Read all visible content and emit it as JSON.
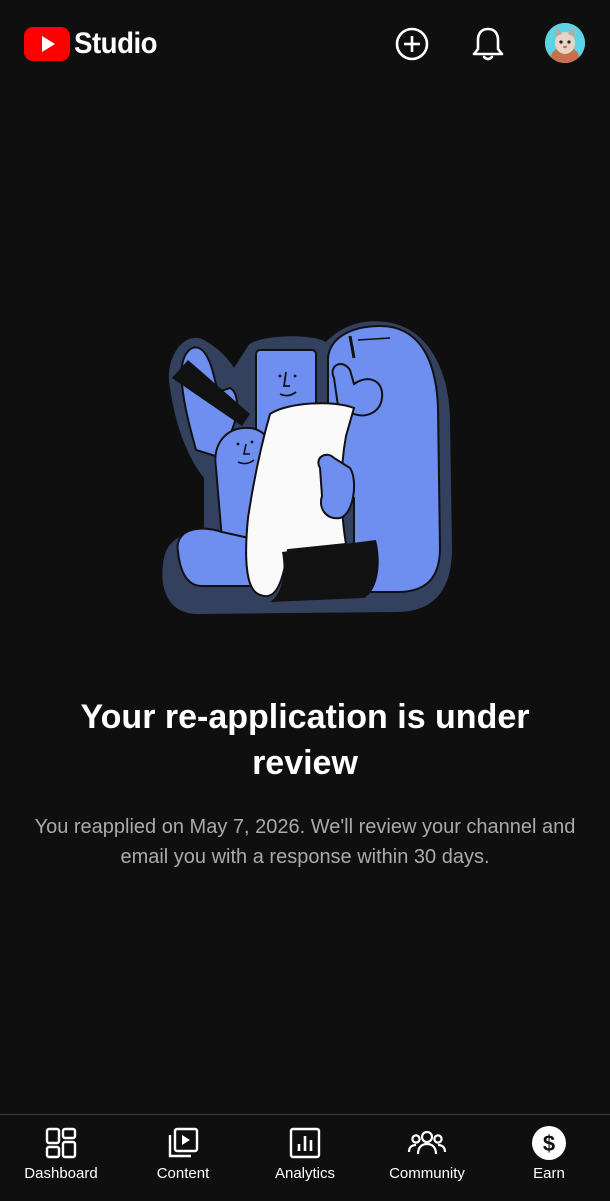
{
  "header": {
    "logo_text": "Studio",
    "icons": [
      "create-icon",
      "notifications-icon",
      "avatar"
    ]
  },
  "main": {
    "title": "Your re-application is under review",
    "subtitle": "You reapplied on May 7, 2026. We'll review your channel and email you with a response within 30 days."
  },
  "bottom_nav": {
    "items": [
      {
        "label": "Dashboard",
        "icon": "dashboard-icon"
      },
      {
        "label": "Content",
        "icon": "content-icon"
      },
      {
        "label": "Analytics",
        "icon": "analytics-icon"
      },
      {
        "label": "Community",
        "icon": "community-icon"
      },
      {
        "label": "Earn",
        "icon": "earn-icon"
      }
    ]
  },
  "colors": {
    "background": "#0f0f0f",
    "brand_red": "#ff0000",
    "illustration_blue": "#6e8ef0",
    "illustration_outline": "#33415f",
    "subtitle_gray": "#aaaaaa"
  }
}
